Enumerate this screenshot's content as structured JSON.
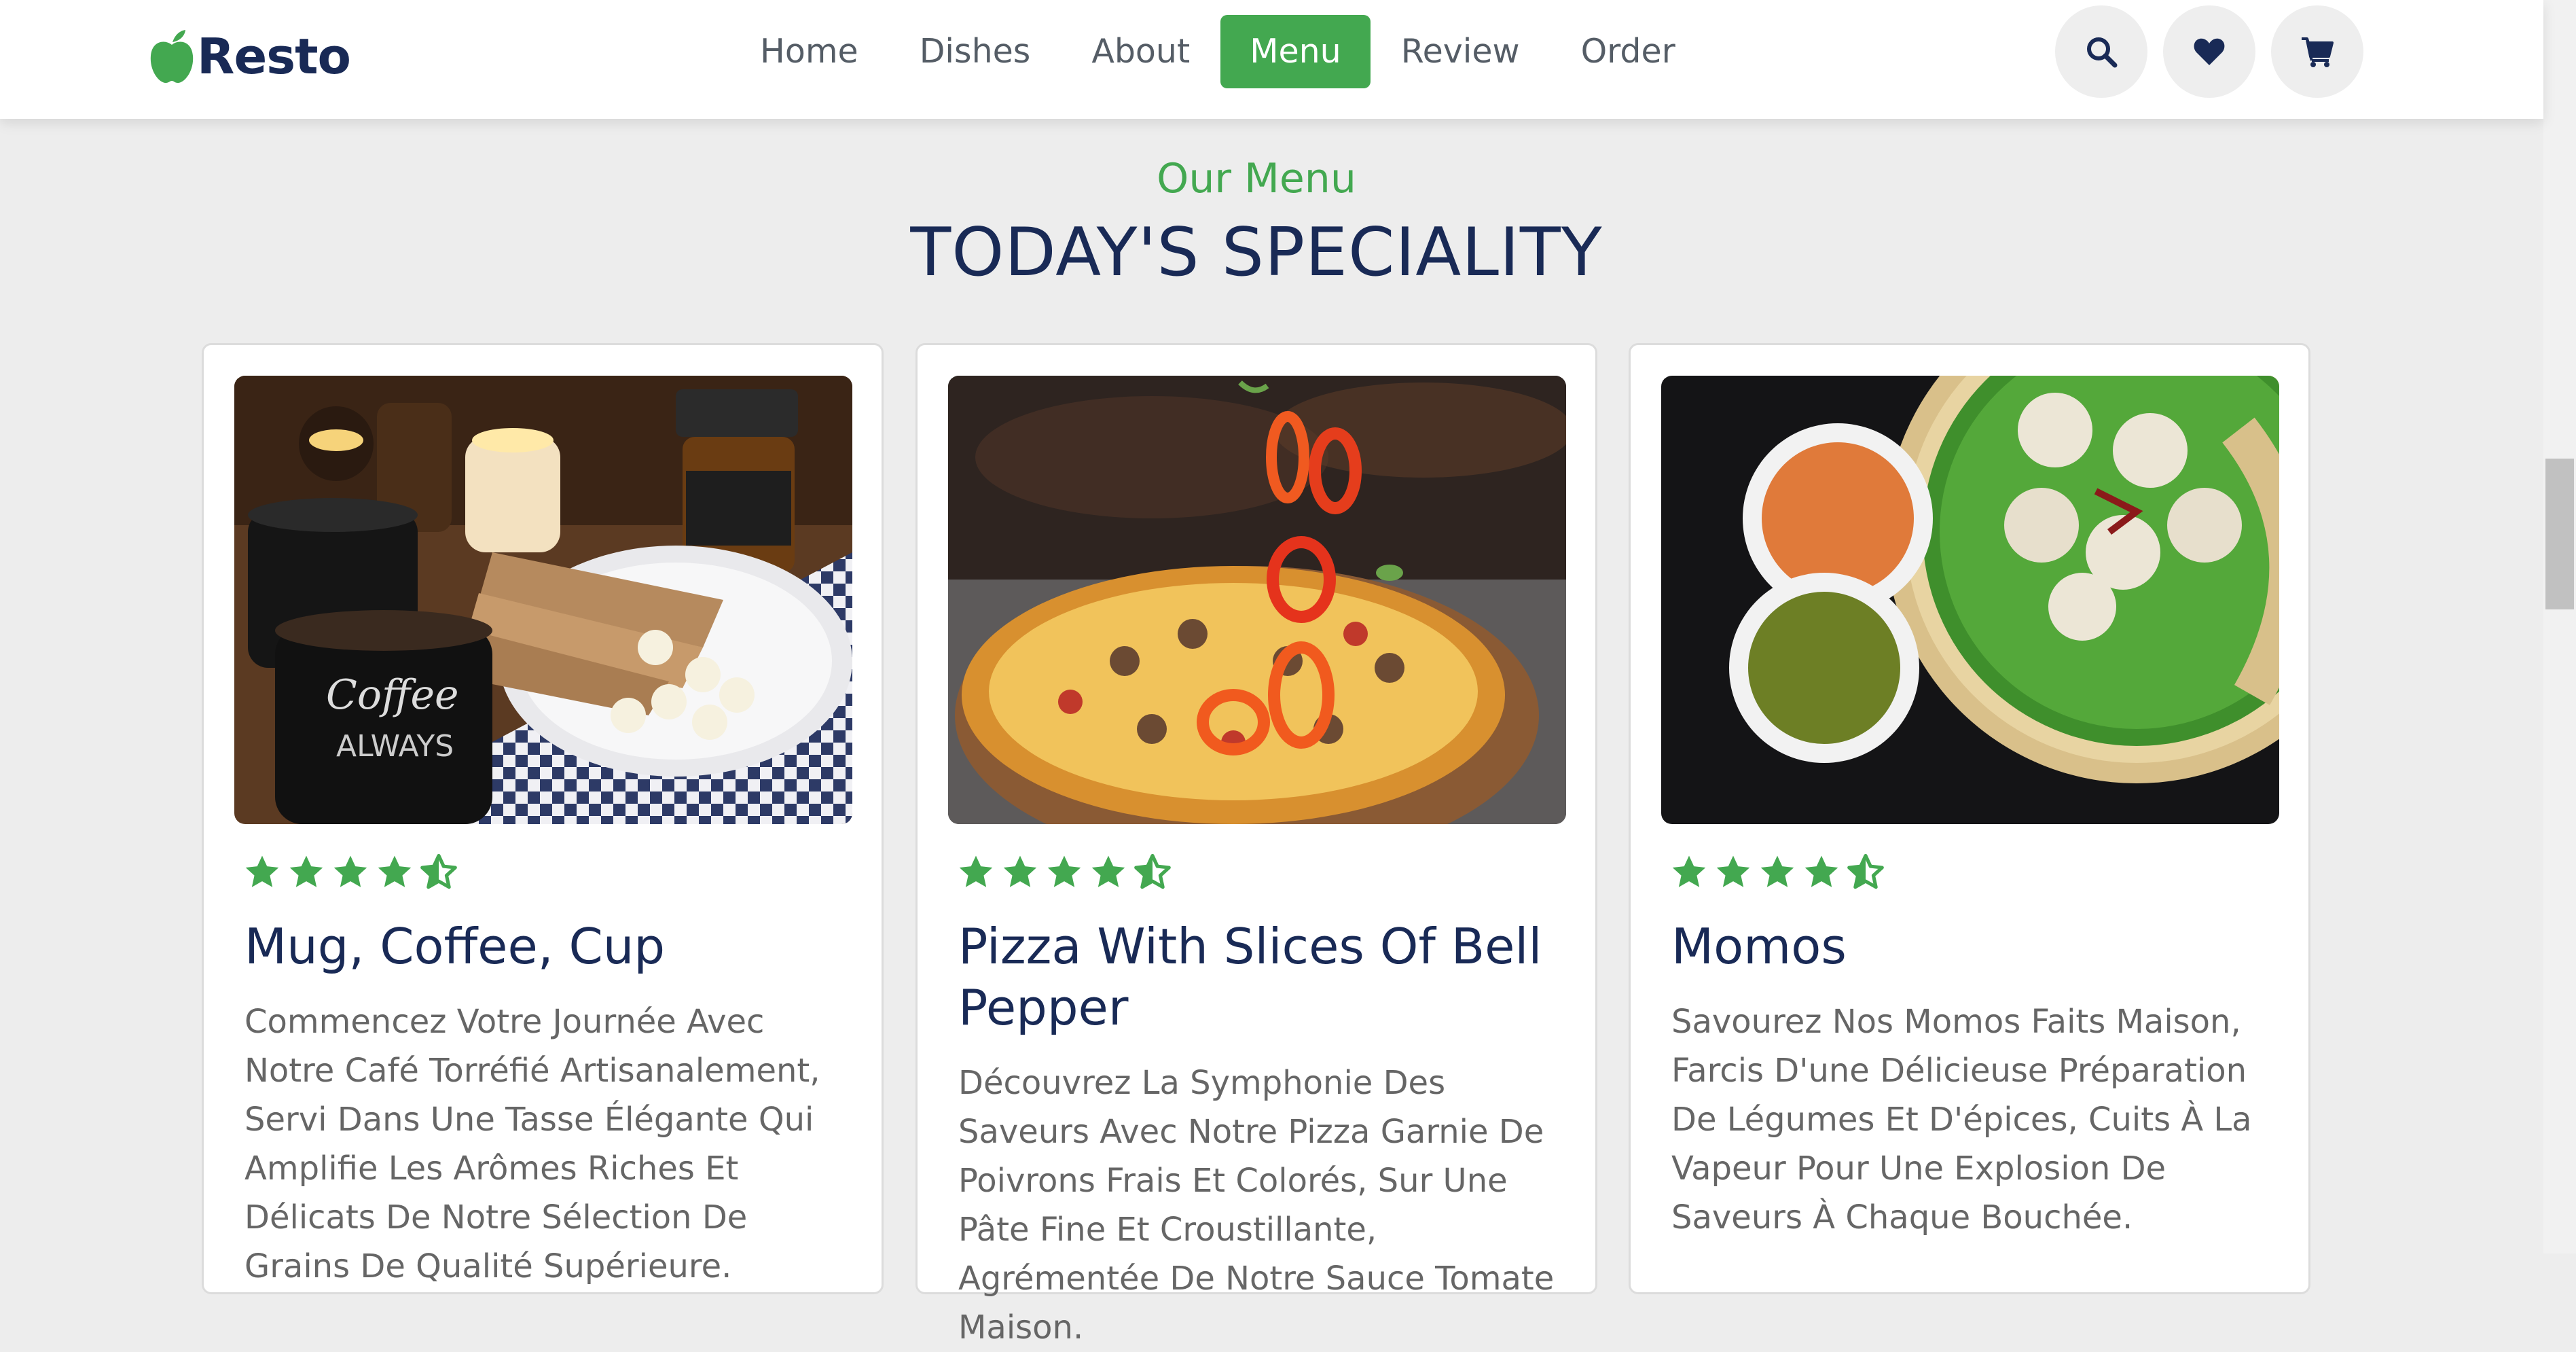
{
  "header": {
    "logo_text": "Resto",
    "logo_icon": "apple-icon",
    "nav": [
      "Home",
      "Dishes",
      "About",
      "Menu",
      "Review",
      "Order"
    ],
    "active_nav": "Menu",
    "actions": [
      "search-icon",
      "heart-icon",
      "cart-icon"
    ]
  },
  "section": {
    "subtitle": "Our Menu",
    "title": "TODAY'S SPECIALITY"
  },
  "cards": [
    {
      "title": "Mug, Coffee, Cup",
      "rating": 4.5,
      "image": "coffee-bread-banana-photo",
      "description": "Commencez Votre Journée Avec Notre Café Torréfié Artisanalement, Servi Dans Une Tasse Élégante Qui Amplifie Les Arômes Riches Et Délicats De Notre Sélection De Grains De Qualité Supérieure."
    },
    {
      "title": "Pizza With Slices Of Bell Pepper",
      "rating": 4.5,
      "image": "pizza-bell-pepper-photo",
      "description": "Découvrez La Symphonie Des Saveurs Avec Notre Pizza Garnie De Poivrons Frais Et Colorés, Sur Une Pâte Fine Et Croustillante, Agrémentée De Notre Sauce Tomate Maison."
    },
    {
      "title": "Momos",
      "rating": 4.5,
      "image": "momos-dumplings-photo",
      "description": "Savourez Nos Momos Faits Maison, Farcis D'une Délicieuse Préparation De Légumes Et D'épices, Cuits À La Vapeur Pour Une Explosion De Saveurs À Chaque Bouchée."
    }
  ],
  "colors": {
    "accent": "#43a850",
    "dark_blue": "#192a56",
    "text_gray": "#666666",
    "background": "#ededed"
  }
}
